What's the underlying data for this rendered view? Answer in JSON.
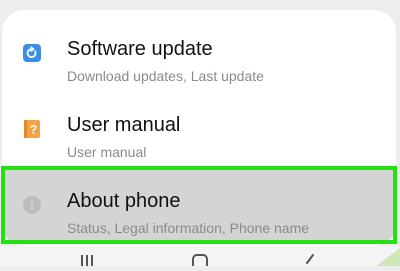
{
  "settings": {
    "items": [
      {
        "title": "Software update",
        "subtitle": "Download updates, Last update",
        "icon": "software-update-icon",
        "icon_color": "#3b8ee8"
      },
      {
        "title": "User manual",
        "subtitle": "User manual",
        "icon": "user-manual-icon",
        "icon_color": "#f4a24a"
      },
      {
        "title": "About phone",
        "subtitle": "Status, Legal information, Phone name",
        "icon": "info-icon",
        "icon_color": "#bdbdbd"
      }
    ]
  },
  "highlight": {
    "color": "#22e012",
    "target": "About phone"
  },
  "navbar": {
    "buttons": [
      "recent-apps-icon",
      "home-icon",
      "back-icon"
    ]
  }
}
